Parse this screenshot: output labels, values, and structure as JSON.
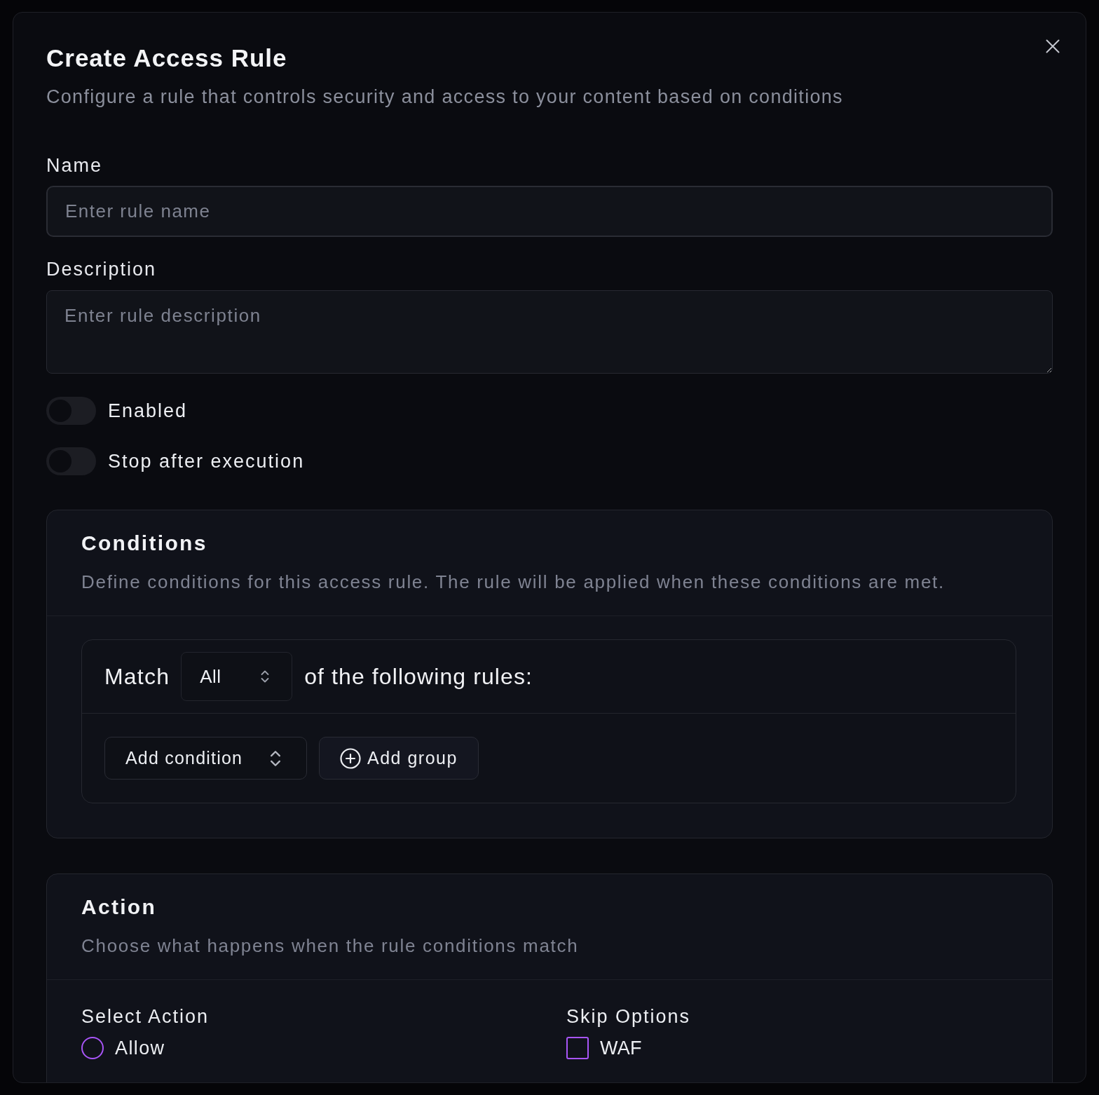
{
  "dialog": {
    "title": "Create Access Rule",
    "description": "Configure a rule that controls security and access to your content based on conditions"
  },
  "fields": [
    {
      "kind": "input",
      "label": "Name",
      "placeholder": "Enter rule name"
    },
    {
      "kind": "textarea",
      "label": "Description",
      "placeholder": "Enter rule description"
    }
  ],
  "toggles": [
    {
      "label": "Enabled",
      "on": false
    },
    {
      "label": "Stop after execution",
      "on": false
    }
  ],
  "conditions": {
    "title": "Conditions",
    "description": "Define conditions for this access rule. The rule will be applied when these conditions are met.",
    "match_label": "Match",
    "match_value": "All",
    "match_suffix": "of the following rules:",
    "buttons": [
      {
        "kind": "select",
        "label": "Add condition"
      },
      {
        "kind": "add",
        "label": "Add group"
      }
    ]
  },
  "action": {
    "title": "Action",
    "description": "Choose what happens when the rule conditions match",
    "select_action": {
      "label": "Select Action",
      "options": [
        {
          "label": "Allow",
          "selected": false
        }
      ]
    },
    "skip_options": {
      "label": "Skip Options",
      "options": [
        {
          "label": "WAF",
          "checked": false
        }
      ]
    }
  }
}
